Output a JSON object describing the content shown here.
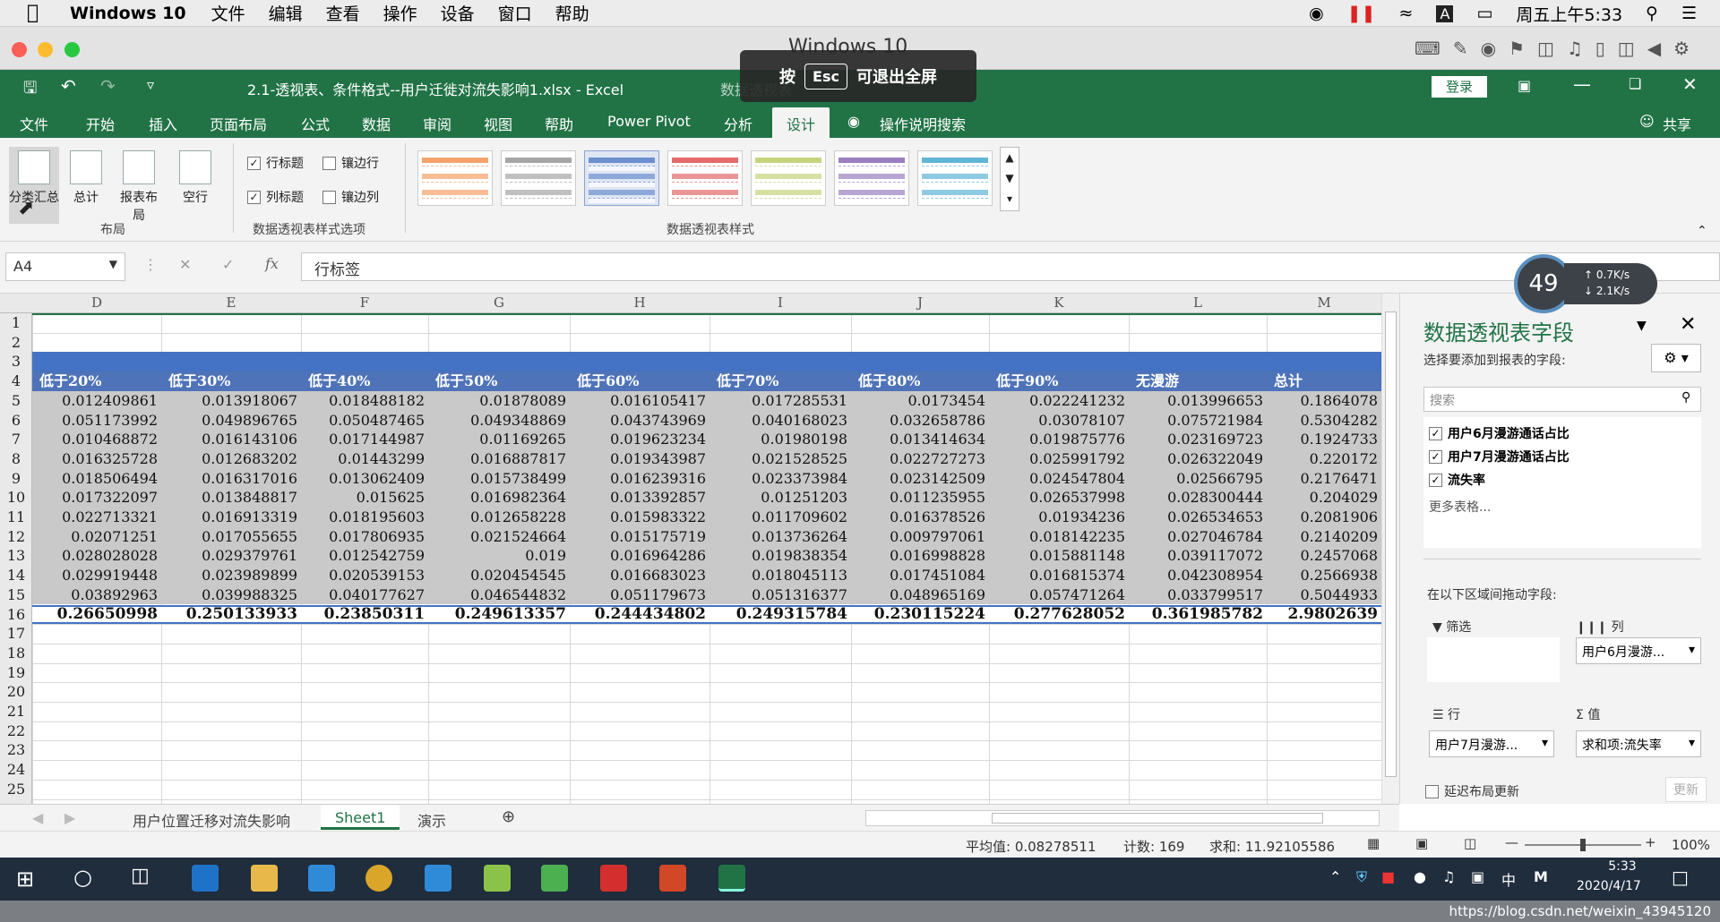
{
  "mac": {
    "app": "Windows 10",
    "menus": [
      "文件",
      "编辑",
      "查看",
      "操作",
      "设备",
      "窗口",
      "帮助"
    ],
    "clock": "周五上午5:33"
  },
  "window": {
    "title": "Windows 10"
  },
  "esc_hint": {
    "pre": "按",
    "key": "Esc",
    "post": "可退出全屏"
  },
  "excel": {
    "filename": "2.1-透视表、条件格式--用户迁徙对流失影响1.xlsx  -  Excel",
    "context": "数据透视表",
    "login": "登录",
    "tabs": [
      "文件",
      "开始",
      "插入",
      "页面布局",
      "公式",
      "数据",
      "审阅",
      "视图",
      "帮助",
      "Power Pivot",
      "分析",
      "设计"
    ],
    "active_tab": "设计",
    "tell_me": "操作说明搜索",
    "share": "共享"
  },
  "ribbon": {
    "layout_buttons": [
      "分类汇总",
      "总计",
      "报表布局",
      "空行"
    ],
    "layout_group": "布局",
    "options": [
      {
        "label": "行标题",
        "checked": true
      },
      {
        "label": "镶边行",
        "checked": false
      },
      {
        "label": "列标题",
        "checked": true
      },
      {
        "label": "镶边列",
        "checked": false
      }
    ],
    "options_group": "数据透视表样式选项",
    "styles_group": "数据透视表样式",
    "style_colors": [
      "#f4a36b",
      "#a6a6a6",
      "#6d8fd0",
      "#e26b6b",
      "#c6d47d",
      "#9b7fc0",
      "#5fb6d6"
    ]
  },
  "formula": {
    "cell": "A4",
    "content": "行标签"
  },
  "speed": {
    "percent": "49",
    "up": "0.7K/s",
    "down": "2.1K/s"
  },
  "grid": {
    "columns": [
      "D",
      "E",
      "F",
      "G",
      "H",
      "I",
      "J",
      "K",
      "L",
      "M"
    ],
    "rows": [
      "1",
      "2",
      "3",
      "4",
      "5",
      "6",
      "7",
      "8",
      "9",
      "10",
      "11",
      "12",
      "13",
      "14",
      "15",
      "16",
      "17",
      "18",
      "19",
      "20",
      "21",
      "22",
      "23",
      "24",
      "25"
    ],
    "header": [
      "低于20%",
      "低于30%",
      "低于40%",
      "低于50%",
      "低于60%",
      "低于70%",
      "低于80%",
      "低于90%",
      "无漫游",
      "总计"
    ],
    "data": [
      [
        "0.012409861",
        "0.013918067",
        "0.018488182",
        "0.01878089",
        "0.016105417",
        "0.017285531",
        "0.0173454",
        "0.022241232",
        "0.013996653",
        "0.1864078"
      ],
      [
        "0.051173992",
        "0.049896765",
        "0.050487465",
        "0.049348869",
        "0.043743969",
        "0.040168023",
        "0.032658786",
        "0.03078107",
        "0.075721984",
        "0.5304282"
      ],
      [
        "0.010468872",
        "0.016143106",
        "0.017144987",
        "0.01169265",
        "0.019623234",
        "0.01980198",
        "0.013414634",
        "0.019875776",
        "0.023169723",
        "0.1924733"
      ],
      [
        "0.016325728",
        "0.012683202",
        "0.01443299",
        "0.016887817",
        "0.019343987",
        "0.021528525",
        "0.022727273",
        "0.025991792",
        "0.026322049",
        "0.220172"
      ],
      [
        "0.018506494",
        "0.016317016",
        "0.013062409",
        "0.015738499",
        "0.016239316",
        "0.023373984",
        "0.023142509",
        "0.024547804",
        "0.02566795",
        "0.2176471"
      ],
      [
        "0.017322097",
        "0.013848817",
        "0.015625",
        "0.016982364",
        "0.013392857",
        "0.01251203",
        "0.011235955",
        "0.026537998",
        "0.028300444",
        "0.204029"
      ],
      [
        "0.022713321",
        "0.016913319",
        "0.018195603",
        "0.012658228",
        "0.015983322",
        "0.011709602",
        "0.016378526",
        "0.01934236",
        "0.026534653",
        "0.2081906"
      ],
      [
        "0.02071251",
        "0.017055655",
        "0.017806935",
        "0.021524664",
        "0.015175719",
        "0.013736264",
        "0.009797061",
        "0.018142235",
        "0.027046784",
        "0.2140209"
      ],
      [
        "0.028028028",
        "0.029379761",
        "0.012542759",
        "0.019",
        "0.016964286",
        "0.019838354",
        "0.016998828",
        "0.015881148",
        "0.039117072",
        "0.2457068"
      ],
      [
        "0.029919448",
        "0.023989899",
        "0.020539153",
        "0.020454545",
        "0.016683023",
        "0.018045113",
        "0.017451084",
        "0.016815374",
        "0.042308954",
        "0.2566938"
      ],
      [
        "0.03892963",
        "0.039988325",
        "0.040177627",
        "0.046544832",
        "0.051179673",
        "0.051316377",
        "0.048965169",
        "0.057471264",
        "0.033799517",
        "0.5044933"
      ]
    ],
    "total": [
      "0.26650998",
      "0.250133933",
      "0.23850311",
      "0.249613357",
      "0.244434802",
      "0.249315784",
      "0.230115224",
      "0.277628052",
      "0.361985782",
      "2.9802639"
    ]
  },
  "pane": {
    "title": "数据透视表字段",
    "hint": "选择要添加到报表的字段:",
    "search": "搜索",
    "fields": [
      "用户6月漫游通话占比",
      "用户7月漫游通话占比",
      "流失率"
    ],
    "more": "更多表格...",
    "drag": "在以下区域间拖动字段:",
    "filter": "筛选",
    "column": "列",
    "column_item": "用户6月漫游...",
    "row": "行",
    "row_item": "用户7月漫游...",
    "value": "值",
    "value_item": "求和项:流失率",
    "defer": "延迟布局更新",
    "update": "更新"
  },
  "sheets": [
    "用户位置迁移对流失影响",
    "Sheet1",
    "演示"
  ],
  "active_sheet": "Sheet1",
  "status": {
    "avg": "平均值: 0.08278511",
    "count": "计数: 169",
    "sum": "求和: 11.92105586",
    "zoom": "100%"
  },
  "taskbar": {
    "time": "5:33",
    "date": "2020/4/17",
    "ime": "中",
    "url": "https://blog.csdn.net/weixin_43945120"
  }
}
